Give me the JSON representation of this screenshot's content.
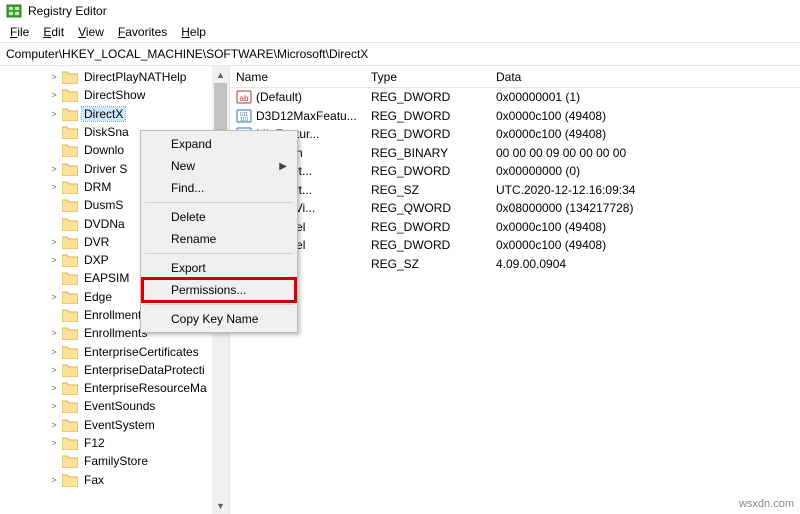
{
  "window": {
    "title": "Registry Editor"
  },
  "menubar": {
    "file": {
      "pre": "F",
      "rest": "ile"
    },
    "edit": {
      "pre": "E",
      "rest": "dit"
    },
    "view": {
      "pre": "V",
      "rest": "iew"
    },
    "favorites": {
      "pre": "F",
      "rest": "avorites"
    },
    "help": {
      "pre": "H",
      "rest": "elp"
    }
  },
  "address": "Computer\\HKEY_LOCAL_MACHINE\\SOFTWARE\\Microsoft\\DirectX",
  "tree": {
    "selected_index": 2,
    "items": [
      {
        "label": "DirectPlayNATHelp",
        "expandable": true
      },
      {
        "label": "DirectShow",
        "expandable": true
      },
      {
        "label": "DirectX",
        "expandable": true
      },
      {
        "label": "DiskSna",
        "expandable": false
      },
      {
        "label": "Downlo",
        "expandable": false
      },
      {
        "label": "Driver S",
        "expandable": true
      },
      {
        "label": "DRM",
        "expandable": true
      },
      {
        "label": "DusmS",
        "expandable": false
      },
      {
        "label": "DVDNa",
        "expandable": false
      },
      {
        "label": "DVR",
        "expandable": true
      },
      {
        "label": "DXP",
        "expandable": true
      },
      {
        "label": "EAPSIM",
        "expandable": false
      },
      {
        "label": "Edge",
        "expandable": true
      },
      {
        "label": "Enrollment",
        "expandable": false
      },
      {
        "label": "Enrollments",
        "expandable": true
      },
      {
        "label": "EnterpriseCertificates",
        "expandable": true
      },
      {
        "label": "EnterpriseDataProtecti",
        "expandable": true
      },
      {
        "label": "EnterpriseResourceMa",
        "expandable": true
      },
      {
        "label": "EventSounds",
        "expandable": true
      },
      {
        "label": "EventSystem",
        "expandable": true
      },
      {
        "label": "F12",
        "expandable": true
      },
      {
        "label": "FamilyStore",
        "expandable": false
      },
      {
        "label": "Fax",
        "expandable": true
      }
    ]
  },
  "ctxmenu": {
    "expand": "Expand",
    "new": "New",
    "find": "Find...",
    "delete": "Delete",
    "rename": "Rename",
    "export": "Export",
    "permissions": "Permissions...",
    "copy_key_name": "Copy Key Name"
  },
  "list": {
    "headers": {
      "name": "Name",
      "type": "Type",
      "data": "Data"
    },
    "rows": [
      {
        "icon": "str",
        "name": "(Default)",
        "type": "REG_DWORD",
        "data": "0x00000001 (1)"
      },
      {
        "icon": "bin",
        "name": "D3D12MaxFeatu...",
        "type": "REG_DWORD",
        "data": "0x0000c100 (49408)"
      },
      {
        "icon": "bin",
        "name": "MinFeatur...",
        "type": "REG_DWORD",
        "data": "0x0000c100 (49408)"
      },
      {
        "icon": "bin",
        "name": "dVersion",
        "type": "REG_BINARY",
        "data": "00 00 00 09 00 00 00 00"
      },
      {
        "icon": "bin",
        "name": "aterStart...",
        "type": "REG_DWORD",
        "data": "0x00000000 (0)"
      },
      {
        "icon": "str",
        "name": "aterStart...",
        "type": "REG_SZ",
        "data": "UTC.2020-12-12.16:09:34"
      },
      {
        "icon": "bin",
        "name": "dicatedVi...",
        "type": "REG_QWORD",
        "data": "0x08000000 (134217728)"
      },
      {
        "icon": "bin",
        "name": "tureLevel",
        "type": "REG_DWORD",
        "data": "0x0000c100 (49408)"
      },
      {
        "icon": "bin",
        "name": "tureLevel",
        "type": "REG_DWORD",
        "data": "0x0000c100 (49408)"
      },
      {
        "icon": "str",
        "name": "",
        "type": "REG_SZ",
        "data": "4.09.00.0904"
      }
    ]
  },
  "watermark": "wsxdn.com"
}
